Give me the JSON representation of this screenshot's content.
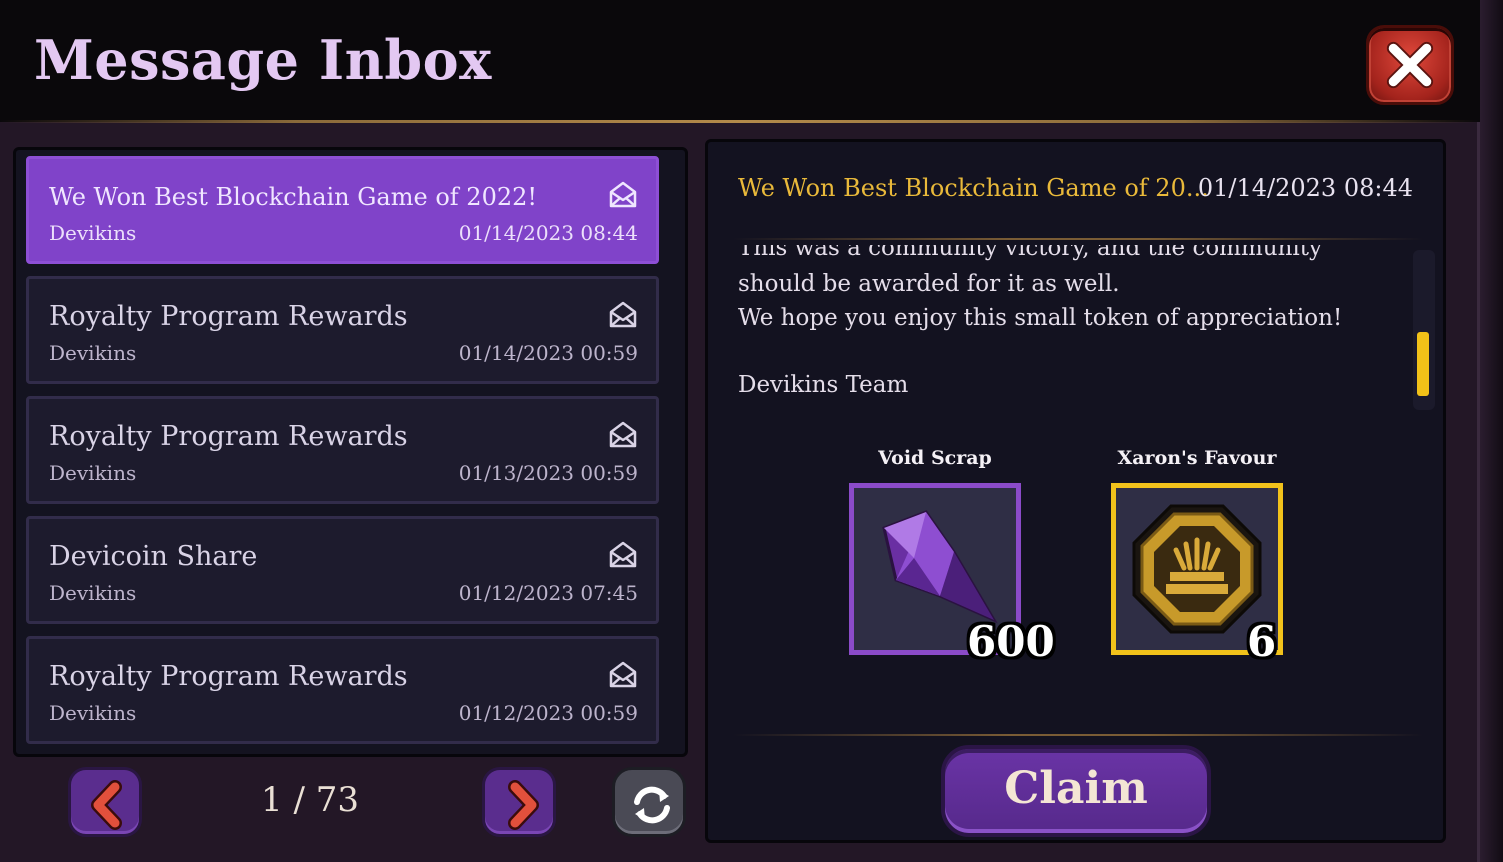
{
  "window": {
    "title": "Message Inbox"
  },
  "messages": [
    {
      "title": "We Won Best Blockchain Game of 2022!",
      "sender": "Devikins",
      "date": "01/14/2023 08:44",
      "selected": true
    },
    {
      "title": "Royalty Program Rewards",
      "sender": "Devikins",
      "date": "01/14/2023 00:59",
      "selected": false
    },
    {
      "title": "Royalty Program Rewards",
      "sender": "Devikins",
      "date": "01/13/2023 00:59",
      "selected": false
    },
    {
      "title": "Devicoin Share",
      "sender": "Devikins",
      "date": "01/12/2023 07:45",
      "selected": false
    },
    {
      "title": "Royalty Program Rewards",
      "sender": "Devikins",
      "date": "01/12/2023 00:59",
      "selected": false
    }
  ],
  "pagination": {
    "label": "1 / 73"
  },
  "detail": {
    "title": "We Won Best Blockchain Game of 20...",
    "date": "01/14/2023 08:44",
    "body": [
      "This was a community victory, and the community",
      "should be awarded for it as well.",
      "We hope you enjoy this small token of appreciation!",
      "",
      "Devikins Team"
    ],
    "rewards": [
      {
        "name": "Void Scrap",
        "count": "600",
        "icon": "purple-crystal-icon",
        "border_color": "#8b4bc9"
      },
      {
        "name": "Xaron's Favour",
        "count": "6",
        "icon": "gold-emblem-icon",
        "border_color": "#f2c21b"
      }
    ],
    "claim_label": "Claim"
  },
  "icons": {
    "close": "close-icon",
    "prev": "chevron-left-icon",
    "next": "chevron-right-icon",
    "refresh": "refresh-icon",
    "envelope": "open-envelope-icon"
  },
  "colors": {
    "accent_purple": "#8043c9",
    "title_gold": "#e9b93a",
    "close_red": "#c8342a"
  }
}
